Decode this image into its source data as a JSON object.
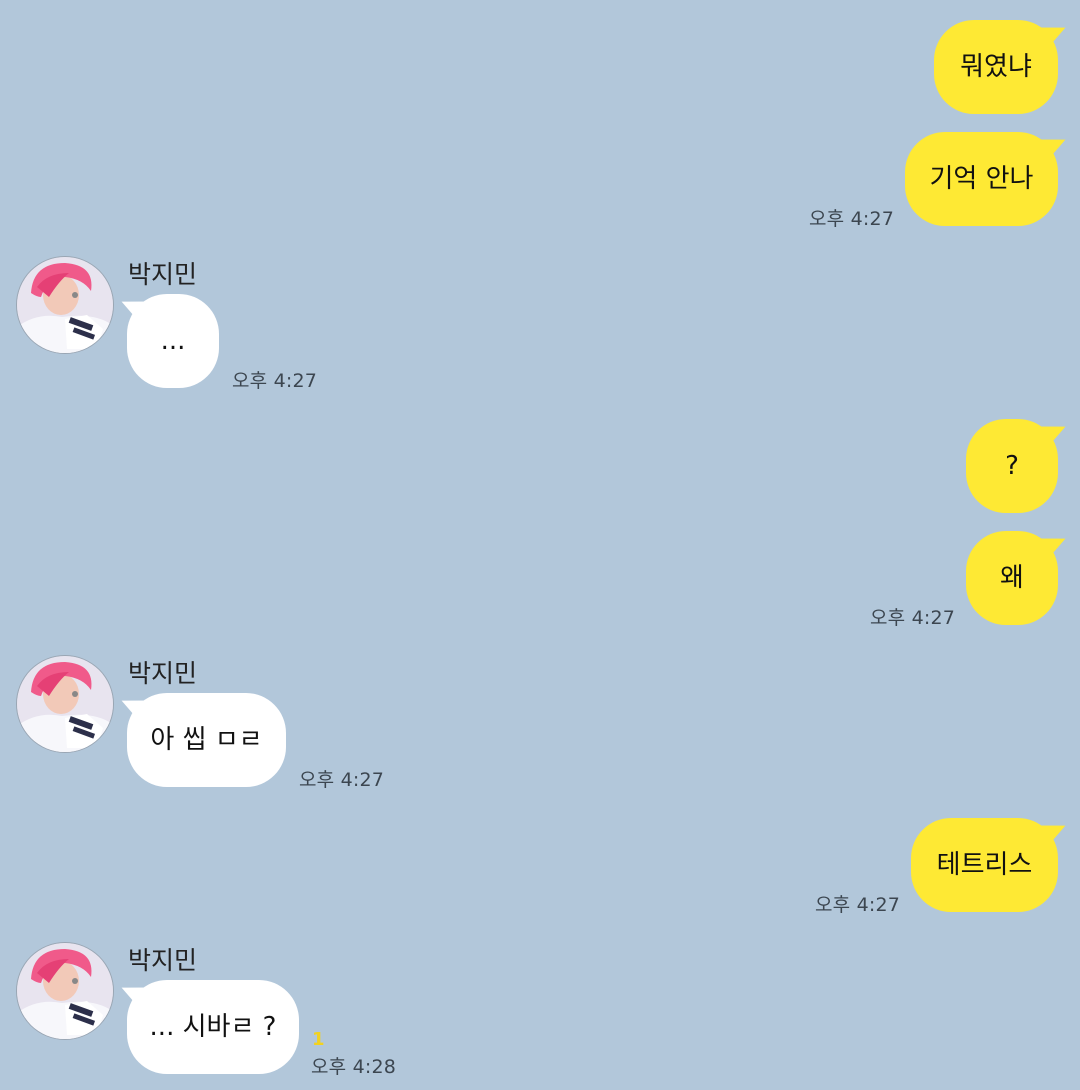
{
  "chat": {
    "messages": [
      {
        "sender": "me",
        "text": "뭐였냐"
      },
      {
        "sender": "me",
        "text": "기억 안나",
        "time": "오후 4:27"
      },
      {
        "sender": "박지민",
        "name": "박지민",
        "text": "...",
        "time": "오후 4:27"
      },
      {
        "sender": "me",
        "text": "?"
      },
      {
        "sender": "me",
        "text": "왜",
        "time": "오후 4:27"
      },
      {
        "sender": "박지민",
        "name": "박지민",
        "text": "아 씹 ㅁㄹ",
        "time": "오후 4:27"
      },
      {
        "sender": "me",
        "text": "테트리스",
        "time": "오후 4:27"
      },
      {
        "sender": "박지민",
        "name": "박지민",
        "text": "... 시바ㄹ ?",
        "time": "오후 4:28",
        "unread": "1"
      }
    ]
  },
  "colors": {
    "background": "#b2c7da",
    "my_bubble": "#fee934",
    "their_bubble": "#ffffff",
    "unread_count": "#f2d21f"
  },
  "icons": {
    "avatar": "profile-photo-pink-hair"
  }
}
